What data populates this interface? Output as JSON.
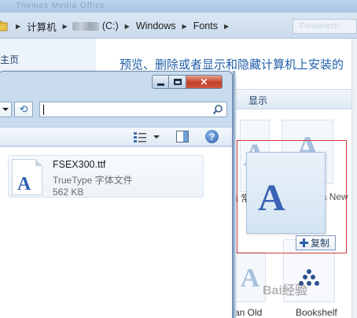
{
  "back_window": {
    "title_strip_text": "Themes    Media    Office",
    "breadcrumbs": [
      "计算机",
      "(C:)",
      "Windows",
      "Fonts"
    ],
    "search_placeholder": "Fontsearch",
    "nav_home": "主页",
    "pane_title": "预览、删除或者显示和隐藏计算机上安装的",
    "cmd_show": "显示",
    "tiles": [
      {
        "label": "s 常规"
      },
      {
        "label": "Angsana New"
      },
      {
        "label": "an Old"
      },
      {
        "label": "Bookshelf"
      }
    ],
    "drag_copy_label": "复制",
    "watermark": "Bai经验"
  },
  "front_window": {
    "controls": {
      "min": "minimize",
      "max": "maximize",
      "close": "×"
    },
    "refresh_glyph": "⟲",
    "file": {
      "name": "FSEX300.ttf",
      "type": "TrueType 字体文件",
      "size": "562 KB"
    },
    "help_glyph": "?"
  },
  "colors": {
    "accent_title": "#1f5fa8",
    "drag_border": "#d43c3c",
    "close_button": "#c4402a"
  }
}
